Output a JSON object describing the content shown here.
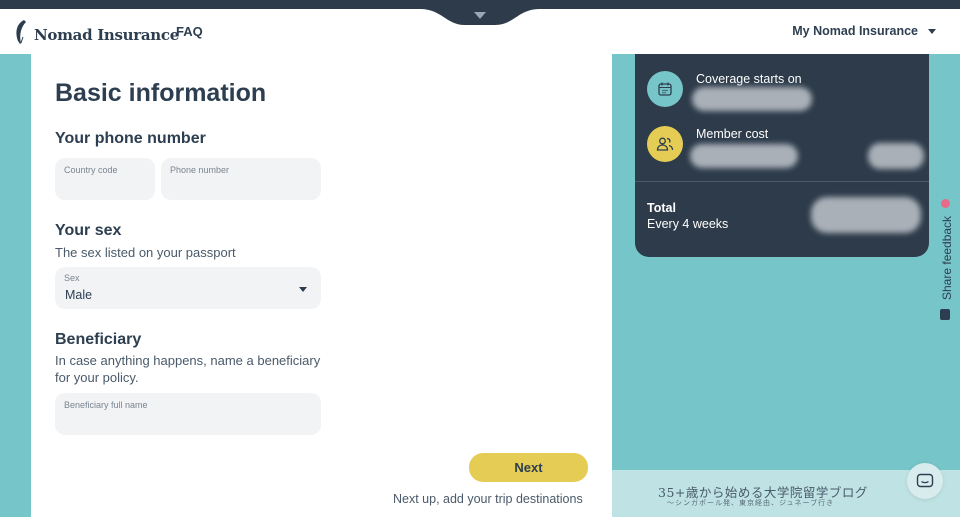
{
  "header": {
    "logo_text": "Nomad Insurance",
    "faq_label": "FAQ",
    "account_menu_label": "My Nomad Insurance"
  },
  "form": {
    "title": "Basic information",
    "phone": {
      "heading": "Your phone number",
      "country_code_placeholder": "Country code",
      "phone_number_placeholder": "Phone number"
    },
    "sex": {
      "heading": "Your sex",
      "hint": "The sex listed on your passport",
      "select_label": "Sex",
      "select_value": "Male"
    },
    "beneficiary": {
      "heading": "Beneficiary",
      "hint": "In case anything happens, name a beneficiary for your policy.",
      "name_placeholder": "Beneficiary full name"
    },
    "next_label": "Next",
    "next_up_text": "Next up, add your trip destinations"
  },
  "summary": {
    "coverage_label": "Coverage starts on",
    "member_cost_label": "Member cost",
    "total_label": "Total",
    "total_period": "Every 4 weeks",
    "icons": {
      "coverage": "calendar-icon",
      "member": "people-icon"
    },
    "colors": {
      "card_bg": "#2d3b4a",
      "coverage_icon_bg": "#76c5c8",
      "member_icon_bg": "#e5cd55"
    }
  },
  "feedback": {
    "label": "Share feedback"
  },
  "blog": {
    "title": "35+歳から始める大学院留学ブログ",
    "subtitle": "〜シンガポール発、東京経由、ジュネーブ行き"
  },
  "colors": {
    "accent_teal": "#76c5c8",
    "accent_yellow": "#e5cd55",
    "dark_navy": "#2d3b4a"
  }
}
